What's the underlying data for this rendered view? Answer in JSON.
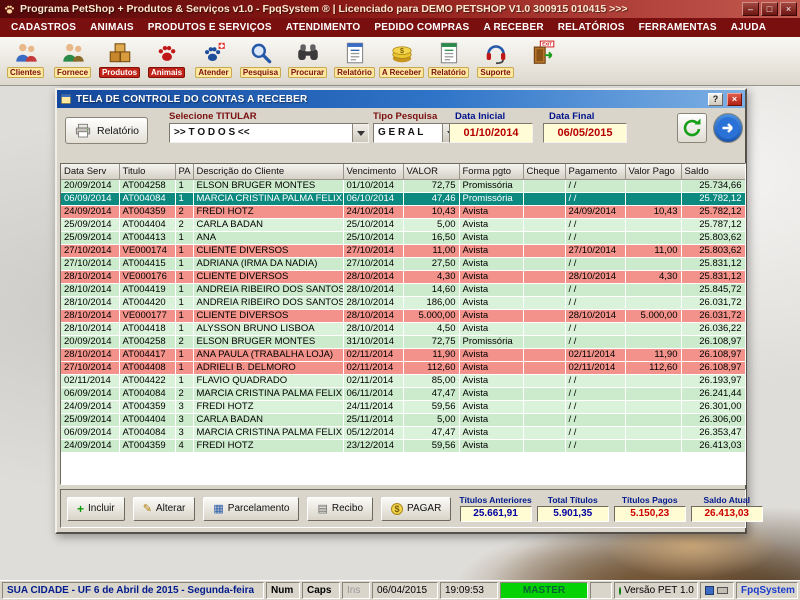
{
  "app": {
    "title": "Programa PetShop + Produtos & Serviços v1.0 - FpqSystem ® | Licenciado para  DEMO PETSHOP V1.0 300915 010415 >>>",
    "window_buttons": {
      "minimize": "–",
      "maximize": "□",
      "close": "×"
    }
  },
  "menu": {
    "items": [
      "CADASTROS",
      "ANIMAIS",
      "PRODUTOS E SERVIÇOS",
      "ATENDIMENTO",
      "PEDIDO COMPRAS",
      "A RECEBER",
      "RELATÓRIOS",
      "FERRAMENTAS",
      "AJUDA"
    ]
  },
  "toolbar": {
    "items": [
      {
        "label": "Clientes"
      },
      {
        "label": "Fornece"
      },
      {
        "label": "Produtos"
      },
      {
        "label": "Animais"
      },
      {
        "label": "Atender"
      },
      {
        "label": "Pesquisa"
      },
      {
        "label": "Procurar"
      },
      {
        "label": "Relatório"
      },
      {
        "label": "A Receber"
      },
      {
        "label": "Relatório"
      },
      {
        "label": "Suporte"
      }
    ],
    "exit_label": "EXIT"
  },
  "window": {
    "title": "TELA DE CONTROLE DO CONTAS A RECEBER",
    "help_button": "?",
    "close_button": "×",
    "filter": {
      "report_button": "Relatório",
      "titular_label": "Selecione TITULAR",
      "titular_value": ">> T O D O S  <<",
      "tipo_label": "Tipo  Pesquisa",
      "tipo_value": "G E R A L",
      "data_inicial_label": "Data Inicial",
      "data_inicial_value": "01/10/2014",
      "data_final_label": "Data Final",
      "data_final_value": "06/05/2015"
    },
    "grid": {
      "columns": [
        "Data Serv",
        "Titulo",
        "PA",
        "Descrição do Cliente",
        "Vencimento",
        "VALOR",
        "Forma pgto",
        "Cheque",
        "Pagamento",
        "Valor Pago",
        "Saldo"
      ],
      "rows": [
        {
          "data_serv": "20/09/2014",
          "titulo": "AT004258",
          "pa": "1",
          "cliente": "ELSON BRUGER MONTES",
          "vencimento": "01/10/2014",
          "valor": "72,75",
          "forma_pgto": "Promissória",
          "cheque": "",
          "pagamento": "/ /",
          "valor_pago": "",
          "saldo": "25.734,66",
          "state": "normal"
        },
        {
          "data_serv": "06/09/2014",
          "titulo": "AT004084",
          "pa": "1",
          "cliente": "MARCIA CRISTINA PALMA FELIX",
          "vencimento": "06/10/2014",
          "valor": "47,46",
          "forma_pgto": "Promissória",
          "cheque": "",
          "pagamento": "/ /",
          "valor_pago": "",
          "saldo": "25.782,12",
          "state": "selected"
        },
        {
          "data_serv": "24/09/2014",
          "titulo": "AT004359",
          "pa": "2",
          "cliente": "FREDI HOTZ",
          "vencimento": "24/10/2014",
          "valor": "10,43",
          "forma_pgto": "Avista",
          "cheque": "",
          "pagamento": "24/09/2014",
          "valor_pago": "10,43",
          "saldo": "25.782,12",
          "state": "paid"
        },
        {
          "data_serv": "25/09/2014",
          "titulo": "AT004404",
          "pa": "2",
          "cliente": "CARLA BADAN",
          "vencimento": "25/10/2014",
          "valor": "5,00",
          "forma_pgto": "Avista",
          "cheque": "",
          "pagamento": "/ /",
          "valor_pago": "",
          "saldo": "25.787,12",
          "state": "normal"
        },
        {
          "data_serv": "25/09/2014",
          "titulo": "AT004413",
          "pa": "1",
          "cliente": "ANA",
          "vencimento": "25/10/2014",
          "valor": "16,50",
          "forma_pgto": "Avista",
          "cheque": "",
          "pagamento": "/ /",
          "valor_pago": "",
          "saldo": "25.803,62",
          "state": "normal"
        },
        {
          "data_serv": "27/10/2014",
          "titulo": "VE000174",
          "pa": "1",
          "cliente": "CLIENTE DIVERSOS",
          "vencimento": "27/10/2014",
          "valor": "11,00",
          "forma_pgto": "Avista",
          "cheque": "",
          "pagamento": "27/10/2014",
          "valor_pago": "11,00",
          "saldo": "25.803,62",
          "state": "paid"
        },
        {
          "data_serv": "27/10/2014",
          "titulo": "AT004415",
          "pa": "1",
          "cliente": "ADRIANA (IRMA DA NADIA)",
          "vencimento": "27/10/2014",
          "valor": "27,50",
          "forma_pgto": "Avista",
          "cheque": "",
          "pagamento": "/ /",
          "valor_pago": "",
          "saldo": "25.831,12",
          "state": "normal"
        },
        {
          "data_serv": "28/10/2014",
          "titulo": "VE000176",
          "pa": "1",
          "cliente": "CLIENTE DIVERSOS",
          "vencimento": "28/10/2014",
          "valor": "4,30",
          "forma_pgto": "Avista",
          "cheque": "",
          "pagamento": "28/10/2014",
          "valor_pago": "4,30",
          "saldo": "25.831,12",
          "state": "paid"
        },
        {
          "data_serv": "28/10/2014",
          "titulo": "AT004419",
          "pa": "1",
          "cliente": "ANDREIA RIBEIRO DOS SANTOS",
          "vencimento": "28/10/2014",
          "valor": "14,60",
          "forma_pgto": "Avista",
          "cheque": "",
          "pagamento": "/ /",
          "valor_pago": "",
          "saldo": "25.845,72",
          "state": "normal"
        },
        {
          "data_serv": "28/10/2014",
          "titulo": "AT004420",
          "pa": "1",
          "cliente": "ANDREIA RIBEIRO DOS SANTOS",
          "vencimento": "28/10/2014",
          "valor": "186,00",
          "forma_pgto": "Avista",
          "cheque": "",
          "pagamento": "/ /",
          "valor_pago": "",
          "saldo": "26.031,72",
          "state": "normal"
        },
        {
          "data_serv": "28/10/2014",
          "titulo": "VE000177",
          "pa": "1",
          "cliente": "CLIENTE DIVERSOS",
          "vencimento": "28/10/2014",
          "valor": "5.000,00",
          "forma_pgto": "Avista",
          "cheque": "",
          "pagamento": "28/10/2014",
          "valor_pago": "5.000,00",
          "saldo": "26.031,72",
          "state": "paid"
        },
        {
          "data_serv": "28/10/2014",
          "titulo": "AT004418",
          "pa": "1",
          "cliente": "ALYSSON BRUNO LISBOA",
          "vencimento": "28/10/2014",
          "valor": "4,50",
          "forma_pgto": "Avista",
          "cheque": "",
          "pagamento": "/ /",
          "valor_pago": "",
          "saldo": "26.036,22",
          "state": "normal"
        },
        {
          "data_serv": "20/09/2014",
          "titulo": "AT004258",
          "pa": "2",
          "cliente": "ELSON BRUGER MONTES",
          "vencimento": "31/10/2014",
          "valor": "72,75",
          "forma_pgto": "Promissória",
          "cheque": "",
          "pagamento": "/ /",
          "valor_pago": "",
          "saldo": "26.108,97",
          "state": "normal"
        },
        {
          "data_serv": "28/10/2014",
          "titulo": "AT004417",
          "pa": "1",
          "cliente": "ANA PAULA (TRABALHA LOJA)",
          "vencimento": "02/11/2014",
          "valor": "11,90",
          "forma_pgto": "Avista",
          "cheque": "",
          "pagamento": "02/11/2014",
          "valor_pago": "11,90",
          "saldo": "26.108,97",
          "state": "paid"
        },
        {
          "data_serv": "27/10/2014",
          "titulo": "AT004408",
          "pa": "1",
          "cliente": "ADRIELI B. DELMORO",
          "vencimento": "02/11/2014",
          "valor": "112,60",
          "forma_pgto": "Avista",
          "cheque": "",
          "pagamento": "02/11/2014",
          "valor_pago": "112,60",
          "saldo": "26.108,97",
          "state": "paid"
        },
        {
          "data_serv": "02/11/2014",
          "titulo": "AT004422",
          "pa": "1",
          "cliente": "FLAVIO QUADRADO",
          "vencimento": "02/11/2014",
          "valor": "85,00",
          "forma_pgto": "Avista",
          "cheque": "",
          "pagamento": "/ /",
          "valor_pago": "",
          "saldo": "26.193,97",
          "state": "normal"
        },
        {
          "data_serv": "06/09/2014",
          "titulo": "AT004084",
          "pa": "2",
          "cliente": "MARCIA CRISTINA PALMA FELIX",
          "vencimento": "06/11/2014",
          "valor": "47,47",
          "forma_pgto": "Avista",
          "cheque": "",
          "pagamento": "/ /",
          "valor_pago": "",
          "saldo": "26.241,44",
          "state": "normal"
        },
        {
          "data_serv": "24/09/2014",
          "titulo": "AT004359",
          "pa": "3",
          "cliente": "FREDI HOTZ",
          "vencimento": "24/11/2014",
          "valor": "59,56",
          "forma_pgto": "Avista",
          "cheque": "",
          "pagamento": "/ /",
          "valor_pago": "",
          "saldo": "26.301,00",
          "state": "normal"
        },
        {
          "data_serv": "25/09/2014",
          "titulo": "AT004404",
          "pa": "3",
          "cliente": "CARLA BADAN",
          "vencimento": "25/11/2014",
          "valor": "5,00",
          "forma_pgto": "Avista",
          "cheque": "",
          "pagamento": "/ /",
          "valor_pago": "",
          "saldo": "26.306,00",
          "state": "normal"
        },
        {
          "data_serv": "06/09/2014",
          "titulo": "AT004084",
          "pa": "3",
          "cliente": "MARCIA CRISTINA PALMA FELIX",
          "vencimento": "05/12/2014",
          "valor": "47,47",
          "forma_pgto": "Avista",
          "cheque": "",
          "pagamento": "/ /",
          "valor_pago": "",
          "saldo": "26.353,47",
          "state": "normal"
        },
        {
          "data_serv": "24/09/2014",
          "titulo": "AT004359",
          "pa": "4",
          "cliente": "FREDI HOTZ",
          "vencimento": "23/12/2014",
          "valor": "59,56",
          "forma_pgto": "Avista",
          "cheque": "",
          "pagamento": "/ /",
          "valor_pago": "",
          "saldo": "26.413,03",
          "state": "normal"
        }
      ]
    },
    "actions": {
      "incluir": "Incluir",
      "alterar": "Alterar",
      "parcelamento": "Parcelamento",
      "recibo": "Recibo",
      "pagar": "PAGAR"
    },
    "summary": [
      {
        "label": "Títulos Anteriores",
        "value": "25.661,91"
      },
      {
        "label": "Total Títulos",
        "value": "5.901,35"
      },
      {
        "label": "Títulos Pagos",
        "value": "5.150,23"
      },
      {
        "label": "Saldo Atual",
        "value": "26.413,03"
      }
    ]
  },
  "statusbar": {
    "location": "SUA CIDADE - UF  6 de Abril de 2015 - Segunda-feira",
    "num": "Num",
    "caps": "Caps",
    "ins": "Ins",
    "date": "06/04/2015",
    "time": "19:09:53",
    "user": "MASTER",
    "version": "Versão PET 1.0",
    "brand": "FpqSystem"
  },
  "colors": {
    "titlebar_red": "#8c1a16",
    "menubar_red": "#7a0f0f",
    "window_blue": "#2f74c8",
    "row_green": "#daf2da",
    "row_paid_red": "#f2928a",
    "row_selected_teal": "#0d8a80",
    "field_yellow": "#fffcd6",
    "value_blue": "#0000a0",
    "value_red": "#cc0000",
    "master_green": "#04d204"
  }
}
